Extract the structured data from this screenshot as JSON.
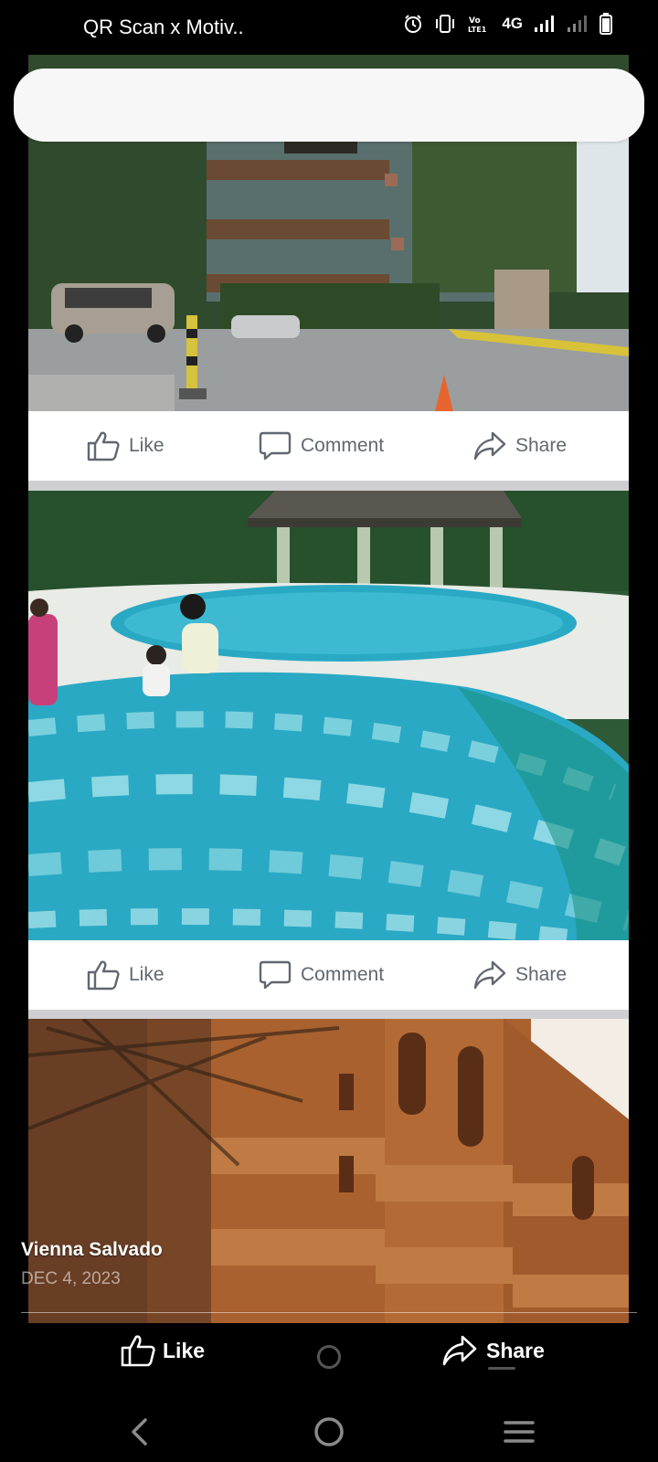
{
  "status_bar": {
    "app_title": "QR Scan x Motiv..",
    "network": "4G",
    "volte": "Vo LTE1",
    "icons": [
      "alarm-icon",
      "vibrate-icon",
      "volte-icon",
      "signal-icon",
      "signal-weak-icon",
      "battery-icon"
    ]
  },
  "search": {
    "placeholder": ""
  },
  "posts": [
    {
      "image": "resort-building-with-parked-car",
      "actions": {
        "like": "Like",
        "comment": "Comment",
        "share": "Share"
      }
    },
    {
      "image": "swimming-pool-with-children",
      "actions": {
        "like": "Like",
        "comment": "Comment",
        "share": "Share"
      }
    },
    {
      "image": "brick-building-with-balconies"
    }
  ],
  "overlay": {
    "author": "Vienna Salvado",
    "date": "DEC 4, 2023",
    "like": "Like",
    "share": "Share"
  },
  "nav_bar": {
    "icons": [
      "back-icon",
      "home-icon",
      "recents-icon"
    ]
  },
  "colors": {
    "action_text": "#606770",
    "feed_bg": "#cfcfd3",
    "pool_water": "#2aa9c4"
  }
}
